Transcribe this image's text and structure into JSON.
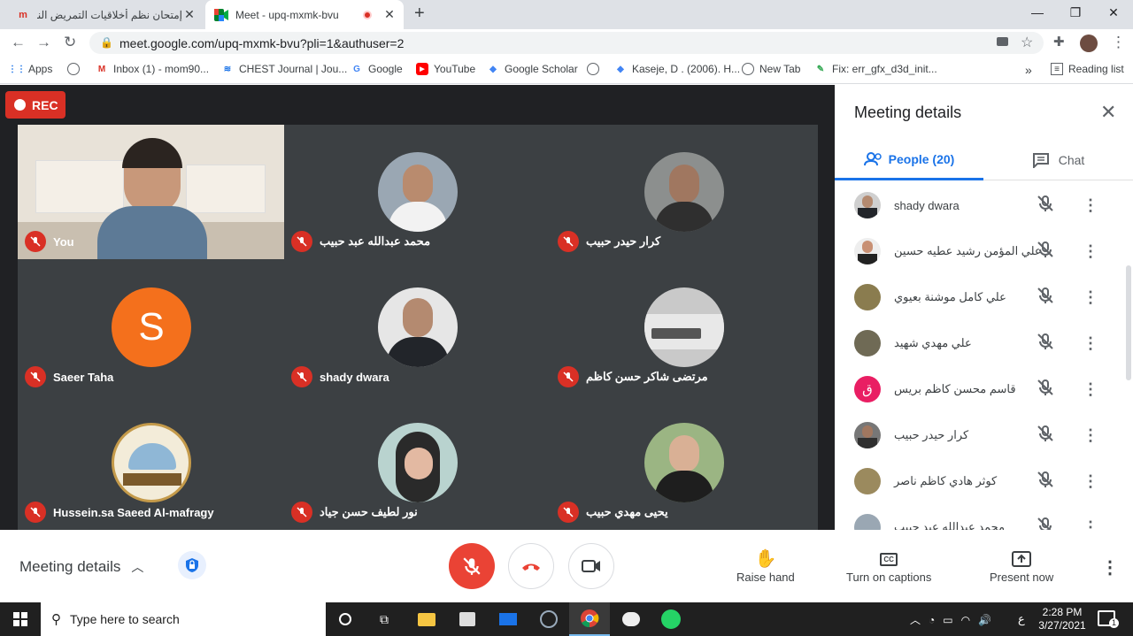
{
  "browser": {
    "tabs": [
      {
        "title": "إمتحان نظم أخلاقيات التمريض النها",
        "icon": "forms-icon"
      },
      {
        "title": "Meet - upq-mxmk-bvu",
        "icon": "meet-icon"
      }
    ],
    "new_tab": "+",
    "url": "meet.google.com/upq-mxmk-bvu?pli=1&authuser=2",
    "bookmarks": [
      {
        "label": "Apps"
      },
      {
        "label": "Inbox (1) - mom90..."
      },
      {
        "label": "CHEST Journal | Jou..."
      },
      {
        "label": "Google"
      },
      {
        "label": "YouTube"
      },
      {
        "label": "Google Scholar"
      },
      {
        "label": "Kaseje, D . (2006). H..."
      },
      {
        "label": "New Tab"
      },
      {
        "label": "Fix: err_gfx_d3d_init..."
      }
    ],
    "more": "»",
    "reading_list": "Reading list"
  },
  "meet": {
    "rec": "REC",
    "tiles": [
      {
        "name": "You"
      },
      {
        "name": "محمد عبدالله عبد حبيب"
      },
      {
        "name": "كرار حيدر حبيب"
      },
      {
        "name": "Saeer Taha",
        "initial": "S",
        "color": "#f4701c"
      },
      {
        "name": "shady dwara"
      },
      {
        "name": "مرتضى شاكر حسن كاظم"
      },
      {
        "name": "Hussein.sa Saeed Al-mafragy"
      },
      {
        "name": "نور لطيف حسن جياد"
      },
      {
        "name": "يحيى مهدي حبيب"
      }
    ],
    "panel": {
      "title": "Meeting details",
      "people_tab": "People (20)",
      "chat_tab": "Chat",
      "people": [
        {
          "name": "shady dwara"
        },
        {
          "name": "علي المؤمن رشيد عطيه حسين"
        },
        {
          "name": "علي كامل موشنة بعيوي"
        },
        {
          "name": "علي مهدي شهيد"
        },
        {
          "name": "قاسم محسن كاظم بريس",
          "initial": "ق",
          "color": "#e91e63"
        },
        {
          "name": "كرار حيدر حبيب"
        },
        {
          "name": "كوثر هادي كاظم ناصر"
        },
        {
          "name": "محمد عبدالله عبد حبيب"
        }
      ]
    },
    "bottom": {
      "meeting_details": "Meeting details",
      "raise_hand": "Raise hand",
      "captions": "Turn on captions",
      "present": "Present now"
    }
  },
  "taskbar": {
    "search_placeholder": "Type here to search",
    "time": "2:28 PM",
    "date": "3/27/2021",
    "lang": "ع",
    "notif": "1"
  }
}
